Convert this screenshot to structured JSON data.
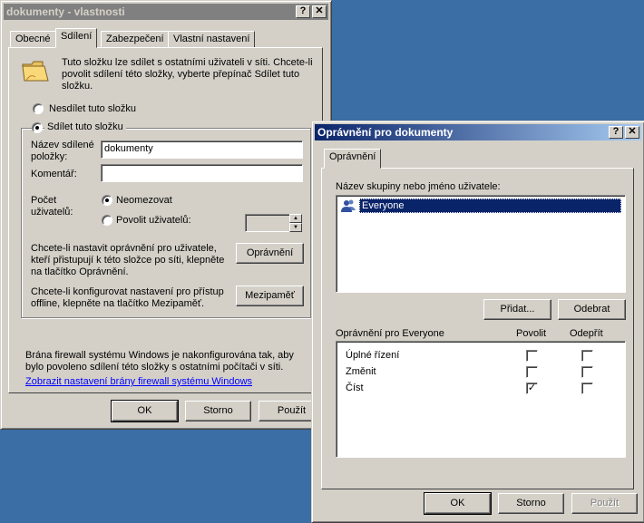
{
  "props_dialog": {
    "title": "dokumenty - vlastnosti",
    "help_btn": "?",
    "close_btn": "✕",
    "tabs": [
      "Obecné",
      "Sdílení",
      "Zabezpečení",
      "Vlastní nastavení"
    ],
    "selected_tab": "Sdílení",
    "intro_text": "Tuto složku lze sdílet s ostatními uživateli v síti. Chcete-li povolit sdílení této složky, vyberte přepínač Sdílet tuto složku.",
    "radio_no_share": "Nesdílet tuto složku",
    "radio_share": "Sdílet tuto složku",
    "share_name_label": "Název sdílené položky:",
    "share_name_value": "dokumenty",
    "comment_label": "Komentář:",
    "comment_value": "",
    "user_count_label": "Počet uživatelů:",
    "radio_unlimited": "Neomezovat",
    "radio_allow": "Povolit uživatelů:",
    "spinner_value": "",
    "permissions_text": "Chcete-li nastavit oprávnění pro uživatele, kteří přistupují k této složce po síti, klepněte na tlačítko Oprávnění.",
    "permissions_button": "Oprávnění",
    "cache_text": "Chcete-li konfigurovat nastavení pro přístup offline, klepněte na tlačítko Mezipaměť.",
    "cache_button": "Mezipaměť",
    "firewall_text": "Brána firewall systému Windows je nakonfigurována tak, aby bylo povoleno sdílení této složky s ostatními počítači v síti.",
    "firewall_link": "Zobrazit nastavení brány firewall systému Windows",
    "ok": "OK",
    "cancel": "Storno",
    "apply": "Použít"
  },
  "perm_dialog": {
    "title": "Oprávnění pro dokumenty",
    "help_btn": "?",
    "close_btn": "✕",
    "tab": "Oprávnění",
    "group_label": "Název skupiny nebo jméno uživatele:",
    "users": [
      {
        "name": "Everyone",
        "icon": "users-group-icon",
        "selected": true
      }
    ],
    "add_button": "Přidat...",
    "remove_button": "Odebrat",
    "perms_header": "Oprávnění pro Everyone",
    "allow_header": "Povolit",
    "deny_header": "Odepřít",
    "permissions": [
      {
        "name": "Úplné řízení",
        "allow": "",
        "deny": ""
      },
      {
        "name": "Změnit",
        "allow": "",
        "deny": ""
      },
      {
        "name": "Číst",
        "allow": "✓",
        "deny": ""
      }
    ],
    "ok": "OK",
    "cancel": "Storno",
    "apply": "Použít"
  },
  "colors": {
    "desktop": "#3a6ea5",
    "face": "#d4d0c8",
    "selection": "#0a246a",
    "link": "#0000ff"
  }
}
